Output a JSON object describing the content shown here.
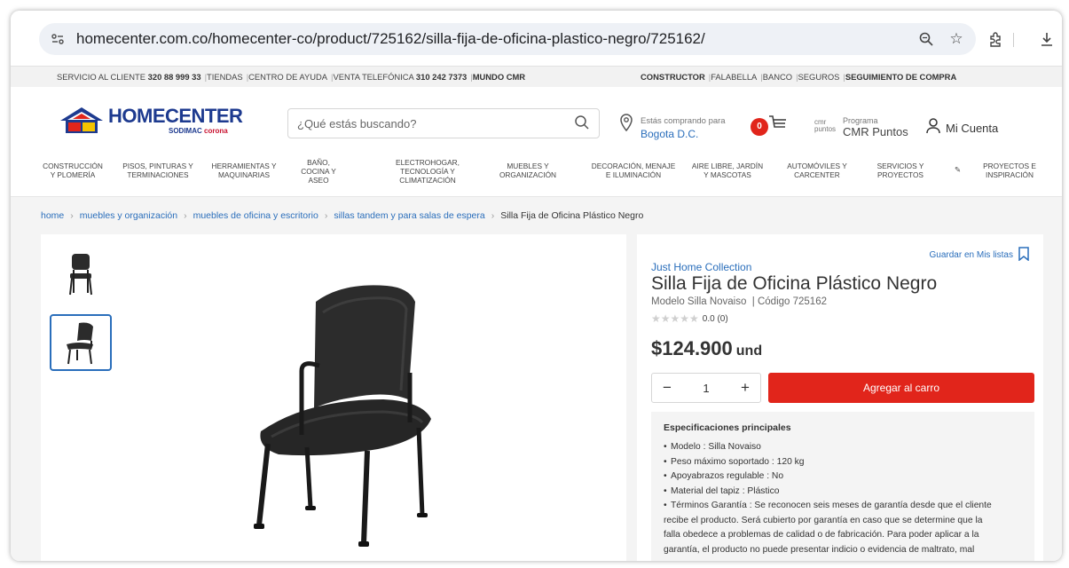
{
  "browser": {
    "url": "homecenter.com.co/homecenter-co/product/725162/silla-fija-de-oficina-plastico-negro/725162/"
  },
  "topbar": {
    "left": [
      {
        "text": "SERVICIO AL CLIENTE ",
        "bold": "320 88 999 33"
      },
      {
        "text": "TIENDAS"
      },
      {
        "text": "CENTRO DE AYUDA"
      },
      {
        "text": "VENTA TELEFÓNICA ",
        "bold": "310 242 7373"
      },
      {
        "text": "",
        "bold": "MUNDO CMR"
      }
    ],
    "right": [
      {
        "text": "",
        "bold": "CONSTRUCTOR"
      },
      {
        "text": "FALABELLA"
      },
      {
        "text": "BANCO"
      },
      {
        "text": "SEGUROS"
      },
      {
        "text": "",
        "bold": "SEGUIMIENTO DE COMPRA"
      }
    ]
  },
  "header": {
    "logo_text": "HOMECENTER",
    "logo_sub_a": "SODIMAC",
    "logo_sub_b": "corona",
    "search_placeholder": "¿Qué estás buscando?",
    "location_small": "Estás comprando para",
    "location_city": "Bogota D.C.",
    "cart_count": "0",
    "cmr_logo": "cmr puntos",
    "cmr_small": "Programa",
    "cmr_main": "CMR Puntos",
    "account_label": "Mi Cuenta"
  },
  "categories": [
    "CONSTRUCCIÓN\nY PLOMERÍA",
    "PISOS, PINTURAS Y\nTERMINACIONES",
    "HERRAMIENTAS Y\nMAQUINARIAS",
    "BAÑO,\nCOCINA Y\nASEO",
    "ELECTROHOGAR,\nTECNOLOGÍA Y\nCLIMATIZACIÓN",
    "MUEBLES Y\nORGANIZACIÓN",
    "DECORACIÓN, MENAJE\nE ILUMINACIÓN",
    "AIRE LIBRE, JARDÍN\nY MASCOTAS",
    "AUTOMÓVILES Y\nCARCENTER",
    "SERVICIOS Y\nPROYECTOS",
    "PROYECTOS E\nINSPIRACIÓN"
  ],
  "breadcrumb": {
    "links": [
      "home",
      "muebles y organización",
      "muebles de oficina y escritorio",
      "sillas tandem y para salas de espera"
    ],
    "current": "Silla Fija de Oficina Plástico Negro"
  },
  "product": {
    "save_list": "Guardar en Mis listas",
    "brand": "Just Home Collection",
    "title": "Silla Fija de Oficina Plástico Negro",
    "model": "Modelo Silla Novaiso",
    "code": "Código 725162",
    "rating_value": 0.0,
    "rating_text": "0.0 (0)",
    "price": "$124.900",
    "price_unit": "und",
    "quantity": "1",
    "add_to_cart": "Agregar al carro",
    "specs_title": "Especificaciones principales",
    "specs": [
      "Modelo : Silla Novaiso",
      "Peso máximo soportado : 120 kg",
      "Apoyabrazos regulable : No",
      "Material del tapiz : Plástico",
      "Términos Garantía : Se reconocen seis meses de garantía desde que el cliente"
    ],
    "specs_cont": [
      "recibe el producto. Será cubierto por garantía en caso que se determine que la",
      "falla obedece a problemas de calidad o de fabricación. Para poder aplicar a la",
      "garantía, el producto no puede presentar indicio o evidencia de maltrato, mal"
    ]
  },
  "colors": {
    "brand_blue": "#1d3a8f",
    "link_blue": "#2a6ebb",
    "cta_red": "#e1251b"
  }
}
